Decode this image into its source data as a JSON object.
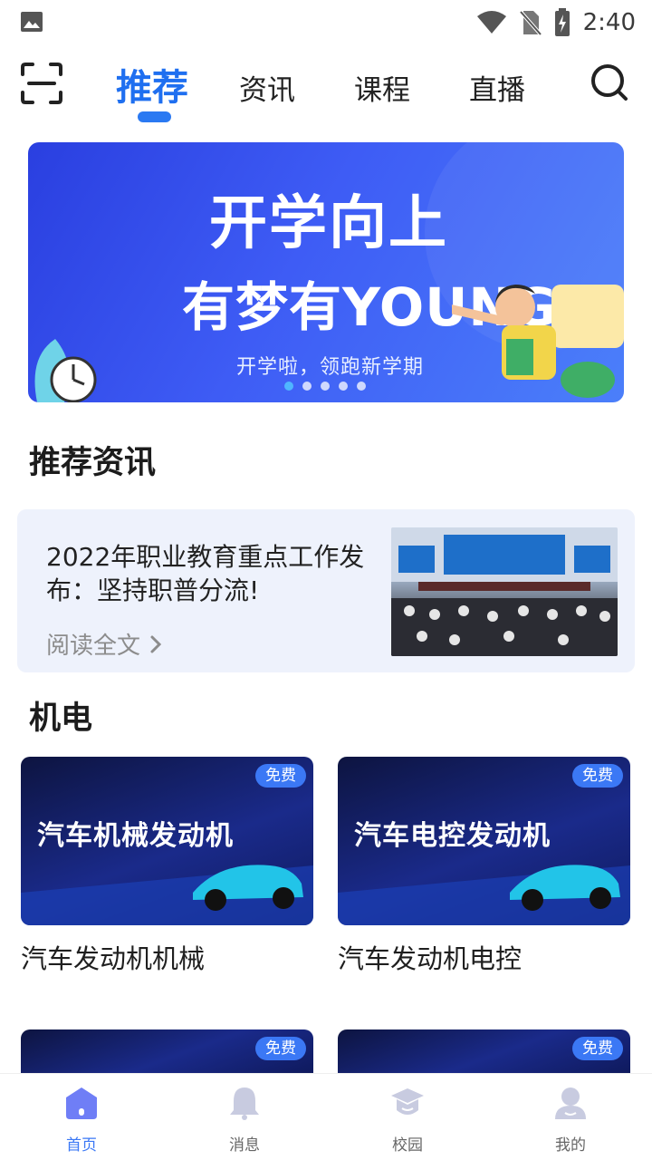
{
  "status_bar": {
    "time": "2:40",
    "icons": [
      "image-icon",
      "wifi-icon",
      "no-sim-icon",
      "battery-charging-icon"
    ]
  },
  "top_nav": {
    "tabs": [
      {
        "label": "推荐",
        "active": true
      },
      {
        "label": "资讯",
        "active": false
      },
      {
        "label": "课程",
        "active": false
      },
      {
        "label": "直播",
        "active": false
      }
    ],
    "left_icon": "scan-icon",
    "right_icon": "search-icon",
    "accent_color": "#1f6ff0"
  },
  "banner": {
    "title_line1": "开学向上",
    "title_line2": "有梦有YOUNG",
    "subtitle": "开学啦，领跑新学期",
    "slide_count": 5,
    "active_slide": 1
  },
  "recommended_news": {
    "heading": "推荐资讯",
    "item": {
      "title": "2022年职业教育重点工作发布：坚持职普分流!",
      "read_more": "阅读全文"
    }
  },
  "category": {
    "heading": "机电",
    "courses": [
      {
        "thumb_title": "汽车机械发动机",
        "badge": "免费",
        "name": "汽车发动机机械"
      },
      {
        "thumb_title": "汽车电控发动机",
        "badge": "免费",
        "name": "汽车发动机电控"
      },
      {
        "thumb_title": "",
        "badge": "免费",
        "name": ""
      },
      {
        "thumb_title": "",
        "badge": "免费",
        "name": ""
      }
    ]
  },
  "bottom_bar": {
    "items": [
      {
        "label": "首页",
        "icon": "home-icon",
        "active": true
      },
      {
        "label": "消息",
        "icon": "bell-icon",
        "active": false
      },
      {
        "label": "校园",
        "icon": "graduation-cap-icon",
        "active": false
      },
      {
        "label": "我的",
        "icon": "user-icon",
        "active": false
      }
    ],
    "active_color": "#3b78f5"
  }
}
